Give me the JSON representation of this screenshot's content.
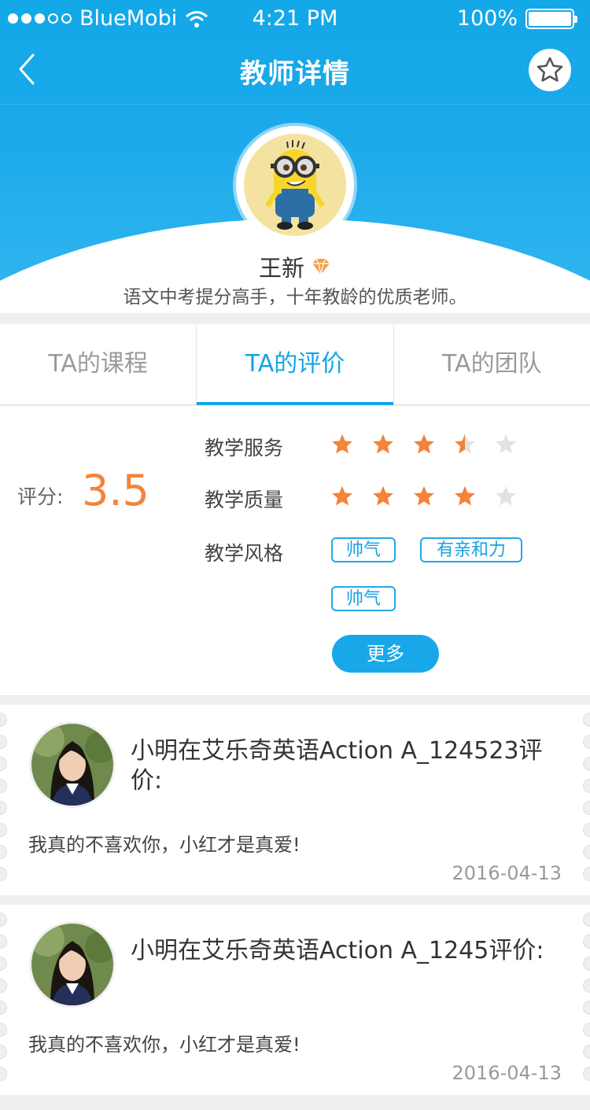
{
  "status_bar": {
    "carrier": "BlueMobi",
    "time": "4:21 PM",
    "battery": "100%"
  },
  "nav": {
    "title": "教师详情"
  },
  "teacher": {
    "name": "王新",
    "desc": "语文中考提分高手，十年教龄的优质老师。"
  },
  "tabs": [
    {
      "label": "TA的课程",
      "active": false
    },
    {
      "label": "TA的评价",
      "active": true
    },
    {
      "label": "TA的团队",
      "active": false
    }
  ],
  "rating": {
    "score_label": "评分:",
    "score": "3.5",
    "service_label": "教学服务",
    "service_stars": 3.5,
    "quality_label": "教学质量",
    "quality_stars": 4,
    "style_label": "教学风格",
    "tags": [
      "帅气",
      "有亲和力",
      "帅气"
    ],
    "more_label": "更多"
  },
  "reviews": [
    {
      "title": "小明在艾乐奇英语Action A_124523评价:",
      "text": "我真的不喜欢你，小红才是真爱!",
      "date": "2016-04-13"
    },
    {
      "title": "小明在艾乐奇英语Action A_1245评价:",
      "text": "我真的不喜欢你，小红才是真爱!",
      "date": "2016-04-13"
    }
  ],
  "colors": {
    "primary": "#18a8ea",
    "accent_orange": "#f5833a",
    "star_empty": "#e2e2e2"
  },
  "icons": {
    "back": "chevron-left-icon",
    "favorite": "star-outline-icon",
    "vip": "diamond-icon",
    "wifi": "wifi-icon"
  }
}
